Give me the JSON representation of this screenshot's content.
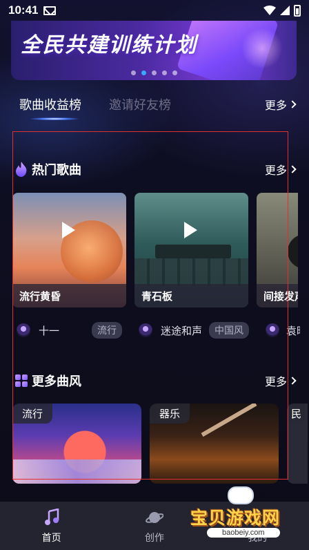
{
  "status_bar": {
    "time": "10:41"
  },
  "banner": {
    "title": "全民共建训练计划",
    "dot_count": 5,
    "active_dot": 1
  },
  "rank_tabs": {
    "tabs": [
      "歌曲收益榜",
      "邀请好友榜"
    ],
    "active_index": 0,
    "more": "更多"
  },
  "hot_songs": {
    "title": "热门歌曲",
    "more": "更多",
    "items": [
      {
        "title": "流行黄昏",
        "artist": "十一",
        "genre": "流行"
      },
      {
        "title": "青石板",
        "artist": "迷途和声",
        "genre": "中国风"
      },
      {
        "title": "间接发声",
        "artist": "袁昭",
        "genre": ""
      }
    ]
  },
  "more_styles": {
    "title": "更多曲风",
    "more": "更多",
    "items": [
      "流行",
      "器乐",
      "民"
    ]
  },
  "bottom_nav": {
    "items": [
      {
        "label": "首页",
        "icon": "music-note-icon",
        "active": true
      },
      {
        "label": "创作",
        "icon": "planet-icon",
        "active": false
      },
      {
        "label": "我的",
        "icon": "profile-icon",
        "active": false
      }
    ]
  },
  "watermark": {
    "text": "宝贝游戏网",
    "url": "baobeiy.com"
  },
  "colors": {
    "accent": "#3aa8ff",
    "highlight_border": "#e23030",
    "nav_bg": "#242430"
  }
}
